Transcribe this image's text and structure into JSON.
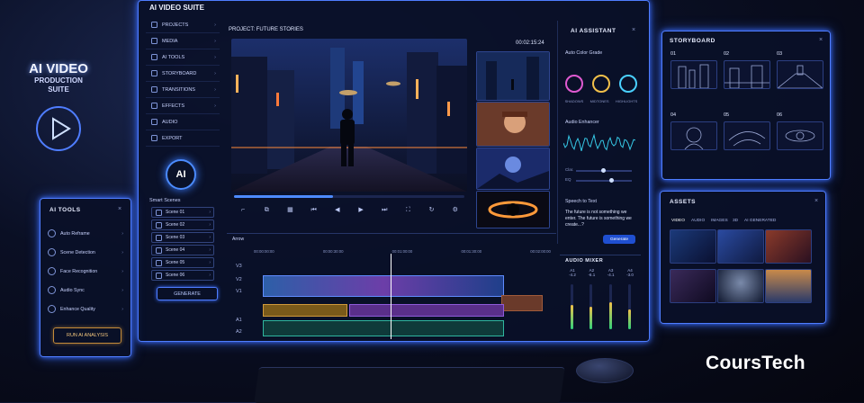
{
  "sign": {
    "line1": "AI VIDEO",
    "line2": "PRODUCTION",
    "line3": "SUITE"
  },
  "app": {
    "title": "AI VIDEO SUITE",
    "project": "PROJECT: FUTURE STORIES",
    "timecode": "00:02:15:24"
  },
  "sidebar": {
    "items": [
      {
        "label": "PROJECTS",
        "icon": "folder-icon"
      },
      {
        "label": "MEDIA",
        "icon": "media-icon"
      },
      {
        "label": "AI TOOLS",
        "icon": "sparkle-icon"
      },
      {
        "label": "STORYBOARD",
        "icon": "storyboard-icon"
      },
      {
        "label": "TRANSITIONS",
        "icon": "transition-icon"
      },
      {
        "label": "EFFECTS",
        "icon": "effects-icon"
      },
      {
        "label": "AUDIO",
        "icon": "audio-icon"
      },
      {
        "label": "EXPORT",
        "icon": "export-icon"
      }
    ],
    "ai_badge": "AI",
    "smart_scenes_label": "Smart Scenes",
    "scenes": [
      "Scene 01",
      "Scene 02",
      "Scene 03",
      "Scene 04",
      "Scene 05",
      "Scene 06"
    ],
    "generate_label": "GENERATE"
  },
  "assistant": {
    "title": "AI ASSISTANT",
    "color_grade": "Auto Color Grade",
    "wheels": [
      "SHADOWS",
      "MIDTONES",
      "HIGHLIGHTS"
    ],
    "audio_enhancer": "Audio Enhancer",
    "sliders": [
      {
        "label": "Clar.",
        "value": 0.45
      },
      {
        "label": "EQ",
        "value": 0.6
      }
    ],
    "speech_to_text": "Speech to Text",
    "transcript": "The future is not something we enter. The future is something we create...?",
    "generate_label": "Generate"
  },
  "timeline": {
    "tab": "Arrow",
    "ruler": [
      "00:00:00:00",
      "00:00:30:00",
      "00:01:00:00",
      "00:01:30:00",
      "00:02:00:00"
    ],
    "tracks": [
      "V3",
      "V2",
      "V1",
      "A1",
      "A2"
    ]
  },
  "mixer": {
    "title": "AUDIO MIXER",
    "channels": [
      {
        "name": "A1",
        "db": "-4.2",
        "level": 0.55
      },
      {
        "name": "A2",
        "db": "-6.1",
        "level": 0.5
      },
      {
        "name": "A3",
        "db": "-4.1",
        "level": 0.6
      },
      {
        "name": "A4",
        "db": "-3.0",
        "level": 0.45
      }
    ]
  },
  "ai_tools": {
    "title": "AI TOOLS",
    "items": [
      "Auto Reframe",
      "Scene Detection",
      "Face Recognition",
      "Audio Sync",
      "Enhance Quality"
    ],
    "run_label": "RUN AI ANALYSIS"
  },
  "storyboard": {
    "title": "STORYBOARD",
    "cells": [
      "01",
      "02",
      "03",
      "04",
      "05",
      "06"
    ]
  },
  "assets": {
    "title": "ASSETS",
    "tabs": [
      "VIDEO",
      "AUDIO",
      "IMAGES",
      "3D",
      "AI GENERATED"
    ]
  },
  "brand": "CoursTech",
  "colors": {
    "accent": "#4f7dff",
    "accent_glow": "#3a6dff",
    "warm": "#f2c67d",
    "wave": "#36c8e6",
    "purple": "#8f5bd9"
  }
}
